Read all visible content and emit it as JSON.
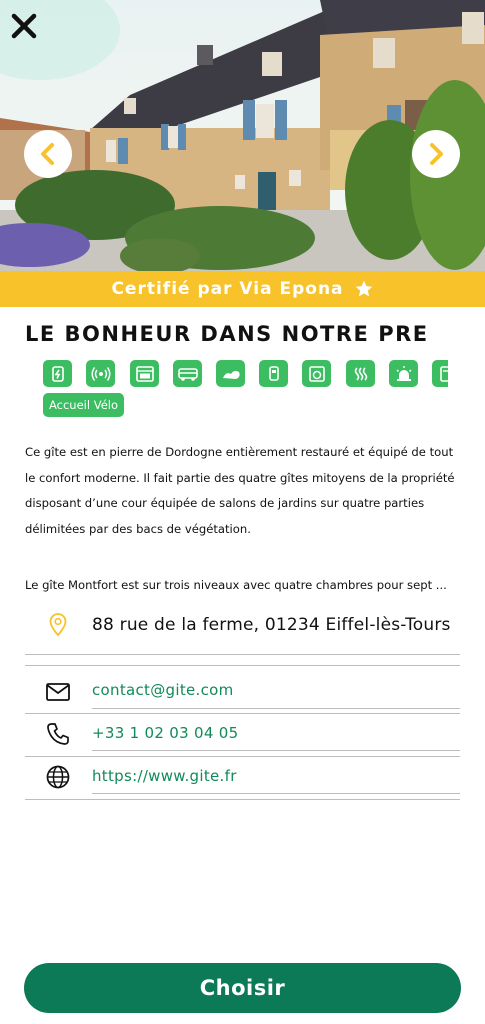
{
  "banner": {
    "certification_text": "Certifié par Via Epona"
  },
  "listing": {
    "title": "LE BONHEUR DANS NOTRE PRE",
    "tag": "Accueil Vélo",
    "description_1": "Ce gîte est en pierre de Dordogne entièrement restauré et équipé de tout le confort moderne. Il fait partie des quatre gîtes mitoyens de la propriété disposant d’une cour équipée de salons de jardins sur quatre parties délimitées par des bacs de végétation.",
    "description_2": "Le gîte Montfort est sur trois niveaux avec quatre chambres pour sept ..."
  },
  "amenities": [
    "charging-station-icon",
    "wifi-icon",
    "oven-icon",
    "bus-icon",
    "laundry-icon",
    "hand-dryer-icon",
    "washing-machine-icon",
    "heating-icon",
    "alarm-light-icon",
    "tablet-icon"
  ],
  "contact": {
    "address": "88 rue de la ferme, 01234 Eiffel-lès-Tours",
    "email": "contact@gite.com",
    "phone": "+33 1 02 03 04 05",
    "website": "https://www.gite.fr"
  },
  "actions": {
    "choose_label": "Choisir"
  },
  "colors": {
    "accent_green": "#3dbd62",
    "dark_green": "#0d7a57",
    "banner_yellow": "#f7c22a",
    "link_green": "#128a59"
  }
}
